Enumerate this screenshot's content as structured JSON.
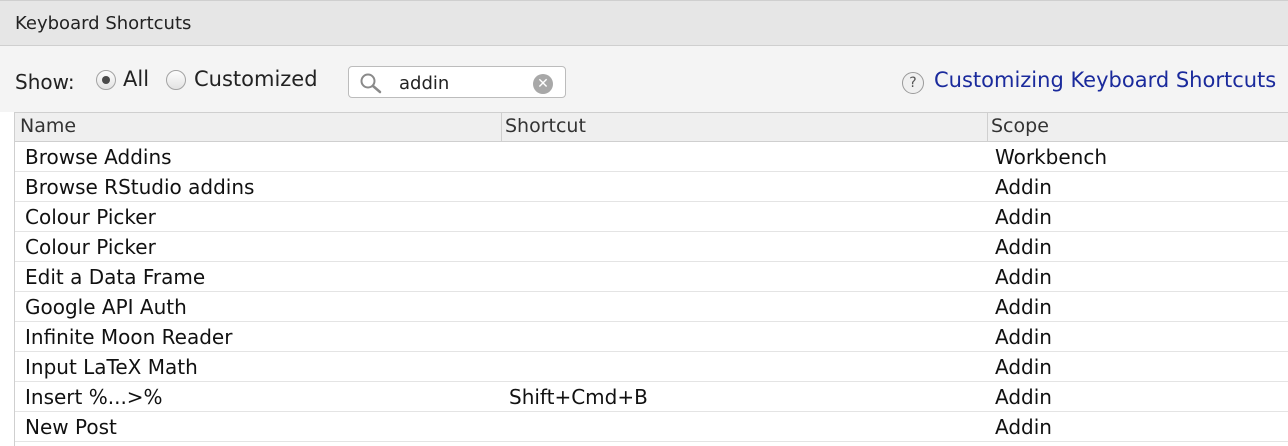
{
  "window": {
    "title": "Keyboard Shortcuts"
  },
  "filter": {
    "show_label": "Show:",
    "options": [
      {
        "label": "All",
        "checked": true
      },
      {
        "label": "Customized",
        "checked": false
      }
    ],
    "search": {
      "value": "addin",
      "icon": "search-icon",
      "clear_icon": "clear-icon"
    }
  },
  "help": {
    "icon": "help-icon",
    "link_text": "Customizing Keyboard Shortcuts",
    "link_color": "#1a2a9c"
  },
  "table": {
    "columns": [
      "Name",
      "Shortcut",
      "Scope"
    ],
    "rows": [
      {
        "name": "Browse Addins",
        "shortcut": "",
        "scope": "Workbench"
      },
      {
        "name": "Browse RStudio addins",
        "shortcut": "",
        "scope": "Addin"
      },
      {
        "name": "Colour Picker",
        "shortcut": "",
        "scope": "Addin"
      },
      {
        "name": "Colour Picker",
        "shortcut": "",
        "scope": "Addin"
      },
      {
        "name": "Edit a Data Frame",
        "shortcut": "",
        "scope": "Addin"
      },
      {
        "name": "Google API Auth",
        "shortcut": "",
        "scope": "Addin"
      },
      {
        "name": "Infinite Moon Reader",
        "shortcut": "",
        "scope": "Addin"
      },
      {
        "name": "Input LaTeX Math",
        "shortcut": "",
        "scope": "Addin"
      },
      {
        "name": "Insert %...>%",
        "shortcut": "Shift+Cmd+B",
        "scope": "Addin"
      },
      {
        "name": "New Post",
        "shortcut": "",
        "scope": "Addin"
      }
    ]
  }
}
